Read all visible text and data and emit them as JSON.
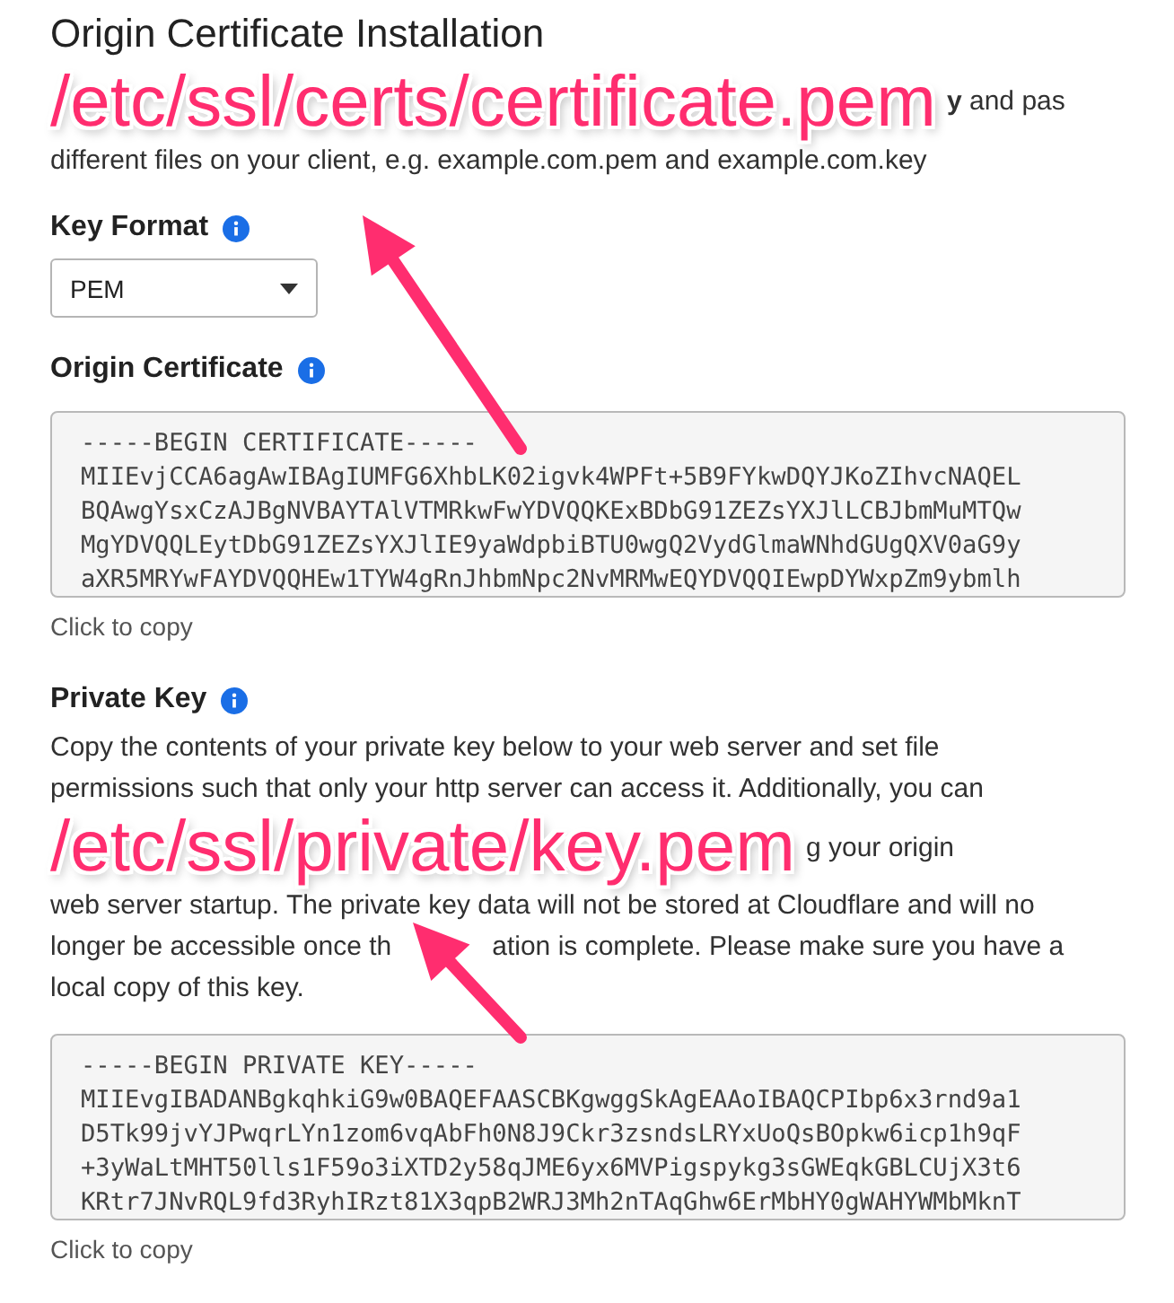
{
  "title": "Origin Certificate Installation",
  "intro": [
    {
      "annotation": "/etc/ssl/certs/certificate.pem",
      "text": "**y** and pas"
    },
    {
      "text": "different files on your client, e.g. example.com.pem and example.com.key"
    }
  ],
  "key_format": {
    "label": "Key Format",
    "value": "PEM"
  },
  "sections": [
    {
      "title": "Origin Certificate",
      "lines": [
        "-----BEGIN CERTIFICATE-----",
        "MIIEvjCCA6agAwIBAgIUMFG6XhbLK02igvk4WPFt+5B9FYkwDQYJKoZIhvcNAQEL",
        "BQAwgYsxCzAJBgNVBAYTAlVTMRkwFwYDVQQKExBDbG91ZEZsYXJlLCBJbmMuMTQw",
        "MgYDVQQLEytDbG91ZEZsYXJlIE9yaWdpbiBTU0wgQ2VydGlmaWNhdGUgQXV0aG9y",
        "aXR5MRYwFAYDVQQHEw1TYW4gRnJhbmNpc2NvMRMwEQYDVQQIEwpDYWxpZm9ybmlh"
      ],
      "copy_hint": "Click to copy"
    },
    {
      "title": "Private Key",
      "description": [
        {
          "text": "Copy the contents of your private key below to your web server and set file"
        },
        {
          "text": "permissions such that only your http server can access it. Additionally, you can"
        },
        {
          "annotation": "/etc/ssl/private/key.pem",
          "text": "g your origin"
        },
        {
          "text": "web server startup. The private key data will not be stored at Cloudflare and will no"
        },
        {
          "text": "longer be accessible once th",
          "after": "ation is complete. Please make sure you have a"
        },
        {
          "text": "local copy of this key."
        }
      ],
      "lines": [
        "-----BEGIN PRIVATE KEY-----",
        "MIIEvgIBADANBgkqhkiG9w0BAQEFAASCBKgwggSkAgEAAoIBAQCPIbp6x3rnd9a1",
        "D5Tk99jvYJPwqrLYn1zom6vqAbFh0N8J9Ckr3zsndsLRYxUoQsBOpkw6icp1h9qF",
        "+3yWaLtMHT50lls1F59o3iXTD2y58qJME6yx6MVPigspykg3sGWEqkGBLCUjX3t6",
        "KRtr7JNvRQL9fd3RyhIRzt81X3qpB2WRJ3Mh2nTAqGhw6ErMbHY0gWAHYWMbMknT"
      ],
      "copy_hint": "Click to copy"
    }
  ]
}
